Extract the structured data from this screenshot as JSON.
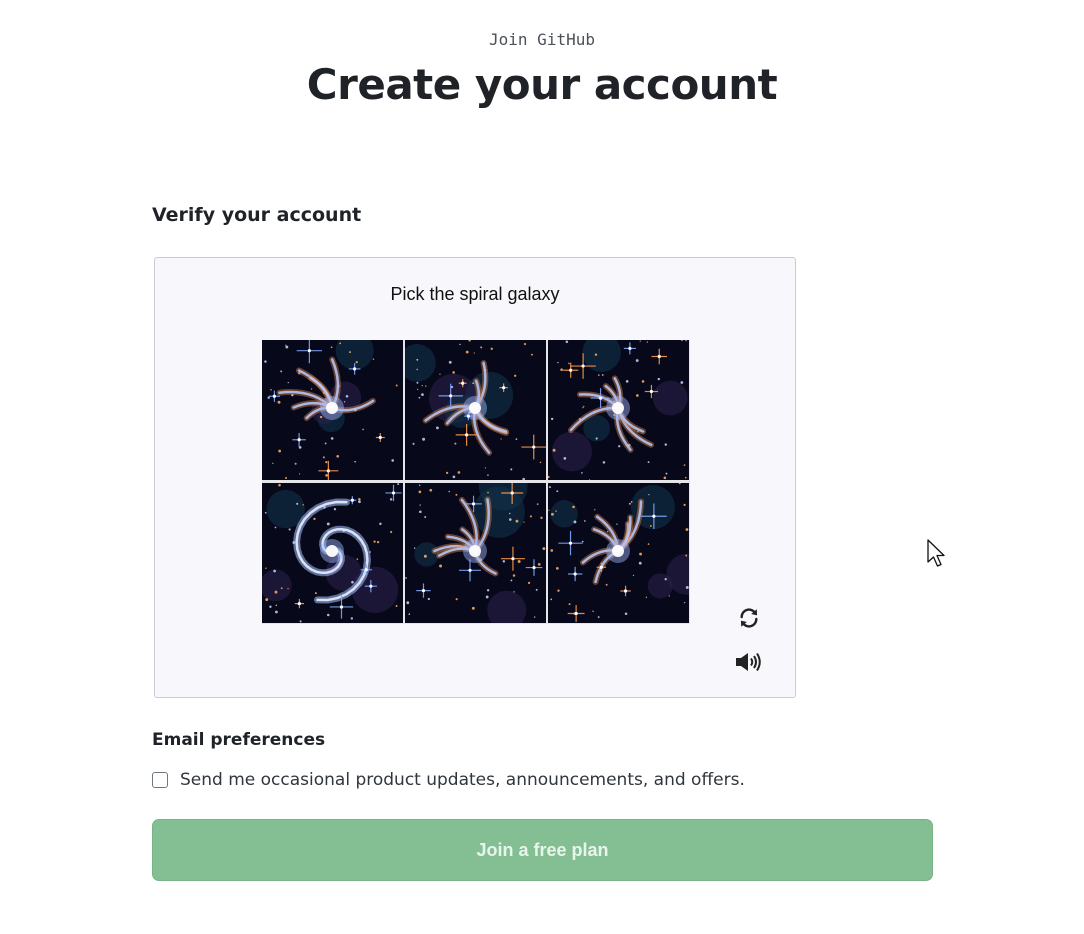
{
  "header": {
    "eyebrow": "Join GitHub",
    "title": "Create your account"
  },
  "verify": {
    "heading": "Verify your account",
    "captcha": {
      "prompt": "Pick the spiral galaxy",
      "tiles": [
        {
          "variant": "irregular"
        },
        {
          "variant": "irregular"
        },
        {
          "variant": "irregular"
        },
        {
          "variant": "spiral"
        },
        {
          "variant": "irregular"
        },
        {
          "variant": "irregular"
        }
      ],
      "controls": {
        "reload_icon": "reload-icon",
        "audio_icon": "speaker-icon"
      }
    }
  },
  "email": {
    "heading": "Email preferences",
    "checkbox_label": "Send me occasional product updates, announcements, and offers.",
    "checked": false
  },
  "submit": {
    "label": "Join a free plan",
    "enabled": false
  },
  "colors": {
    "button_bg": "#83bf92",
    "captcha_bg": "#f8f8fc",
    "tile_bg": "#07081a"
  }
}
